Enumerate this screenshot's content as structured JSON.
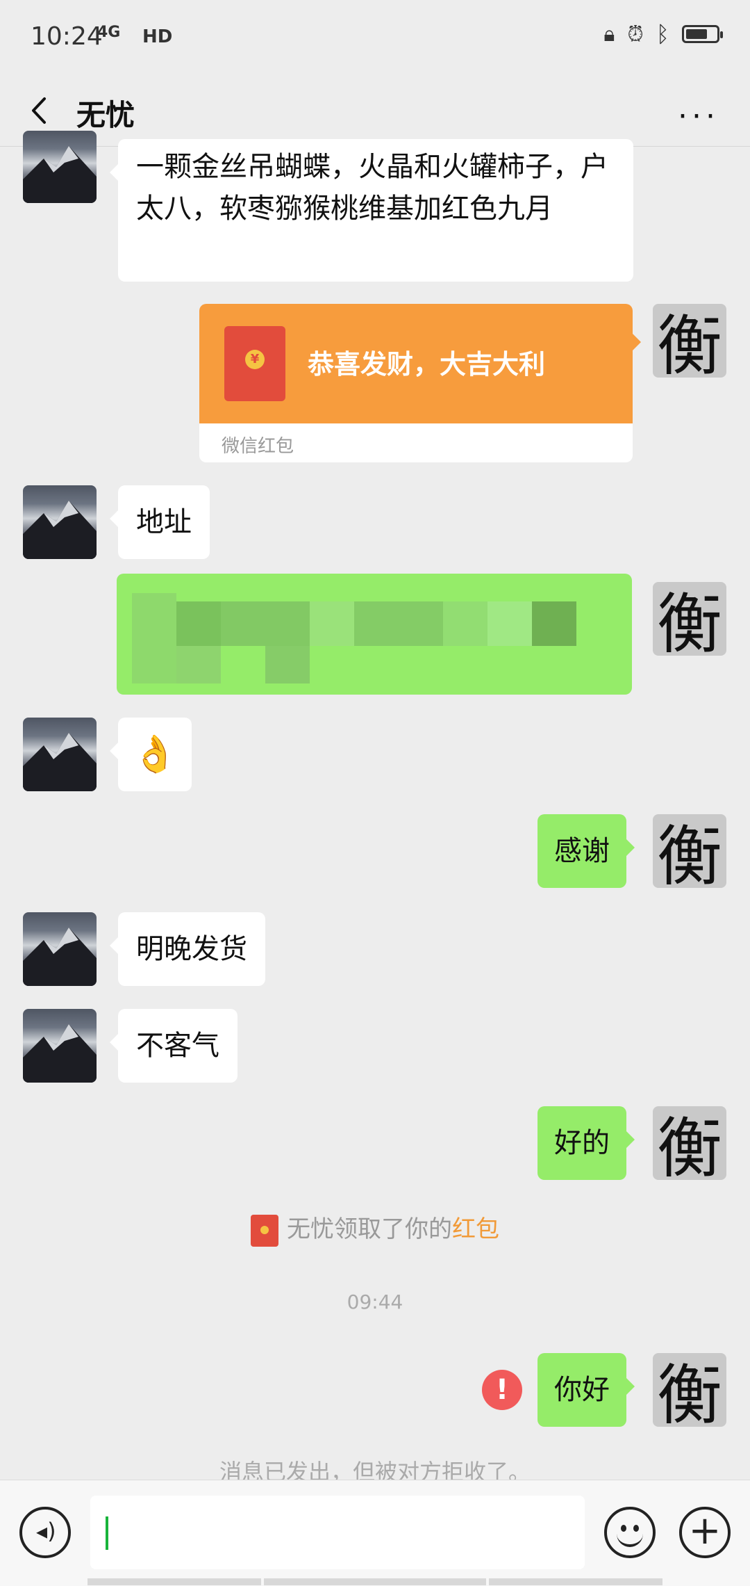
{
  "status_bar": {
    "time": "10:24",
    "network": "4G",
    "hd": "HD",
    "icons": [
      "lock-icon",
      "alarm-icon",
      "bluetooth-icon",
      "battery-icon"
    ]
  },
  "header": {
    "title": "无忧",
    "back_icon": "chevron-left-icon",
    "more_icon": "more-icon"
  },
  "messages": {
    "incoming_1": "一颗金丝吊蝴蝶，火晶和火罐柿子，户太八，软枣猕猴桃维基加红色九月",
    "red_packet": {
      "label": "恭喜发财，大吉大利",
      "footer": "微信红包",
      "coin": "¥"
    },
    "incoming_2": "地址",
    "incoming_3": "👌",
    "outgoing_1": "感谢",
    "incoming_4": "明晚发货",
    "incoming_5": "不客气",
    "outgoing_2": "好的",
    "system_notice": {
      "prefix": "无忧领取了你的",
      "link": "红包"
    },
    "timestamp": "09:44",
    "outgoing_3": "你好",
    "error_mark": "!",
    "rejected_notice": "消息已发出，但被对方拒收了。"
  },
  "avatars": {
    "self_char": "衡"
  },
  "input_bar": {
    "voice_icon": "voice-icon",
    "emoji_icon": "emoji-icon",
    "plus_icon": "plus-icon",
    "plus_glyph": "+"
  }
}
